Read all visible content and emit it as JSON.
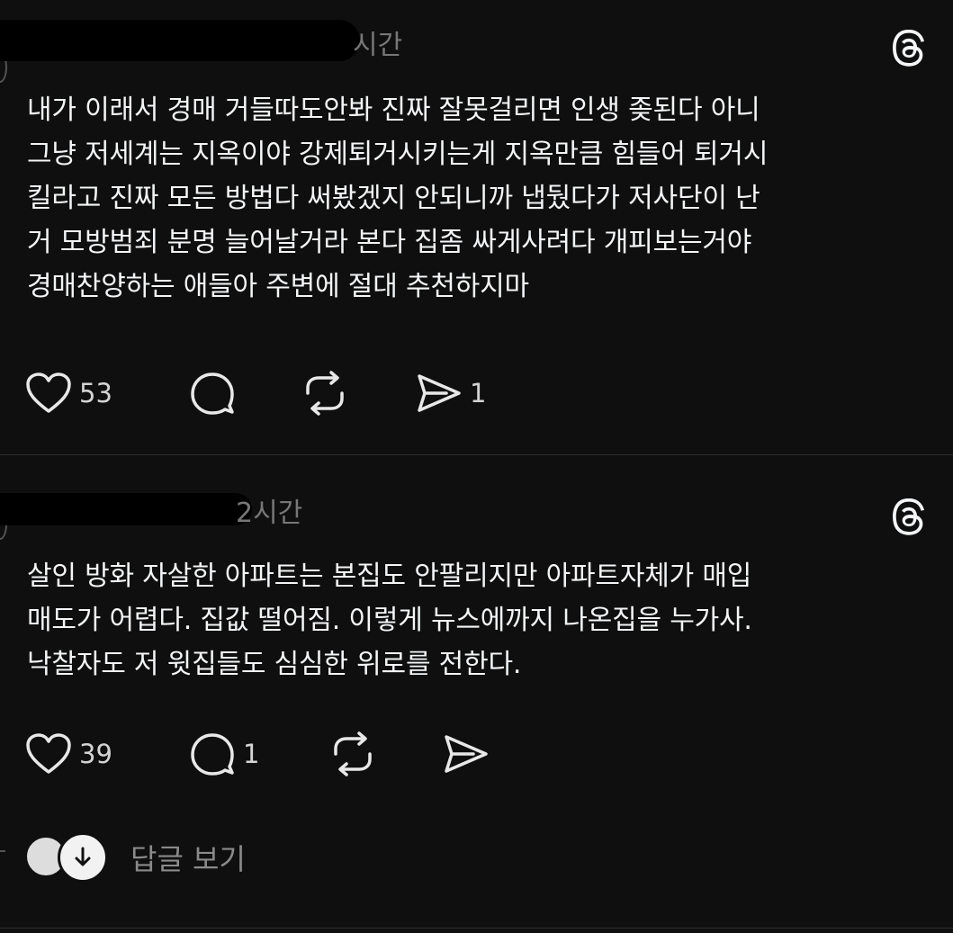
{
  "posts": [
    {
      "time": "시간",
      "body_lines": [
        "내가 이래서 경매 거들따도안봐 진짜 잘못걸리면 인생 좆된다 아니",
        "그냥 저세계는 지옥이야 강제퇴거시키는게 지옥만큼 힘들어 퇴거시",
        "킬라고 진짜 모든 방법다 써봤겠지 안되니까 냅뒀다가 저사단이 난",
        "거 모방범죄 분명 늘어날거라 본다 집좀 싸게사려다 개피보는거야",
        "경매찬양하는 애들아 주변에 절대 추천하지마"
      ],
      "likes": "53",
      "comments": "",
      "reposts": "",
      "shares": "1"
    },
    {
      "time": "2시간",
      "body_lines": [
        "살인 방화 자살한 아파트는 본집도 안팔리지만 아파트자체가 매입",
        "매도가 어렵다. 집값 떨어짐.  이렇게 뉴스에까지 나온집을 누가사.",
        "낙찰자도 저 윗집들도 심심한 위로를 전한다."
      ],
      "likes": "39",
      "comments": "1",
      "reposts": "",
      "shares": ""
    }
  ],
  "replies_label": "답글 보기",
  "icons": {
    "brand": "threads-icon",
    "like": "heart-icon",
    "comment": "comment-icon",
    "repost": "repost-icon",
    "share": "send-icon",
    "reply_expand": "arrow-down-icon"
  },
  "colors": {
    "background": "#0f0f0f",
    "text": "#f3f5f7",
    "muted": "#777777"
  }
}
